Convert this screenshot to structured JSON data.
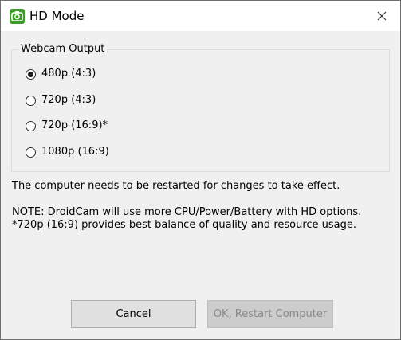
{
  "window": {
    "title": "HD Mode",
    "app_icon": "droidcam-camera-icon",
    "close_icon": "close-icon"
  },
  "group": {
    "legend": "Webcam Output",
    "options": [
      {
        "label": "480p (4:3)",
        "selected": true
      },
      {
        "label": "720p (4:3)",
        "selected": false
      },
      {
        "label": "720p (16:9)*",
        "selected": false
      },
      {
        "label": "1080p (16:9)",
        "selected": false
      }
    ]
  },
  "messages": {
    "restart_notice": "The computer needs to be restarted for changes to take effect.",
    "note_line1": "NOTE: DroidCam will use more CPU/Power/Battery with HD options.",
    "note_line2": "*720p (16:9) provides best balance of quality and resource usage."
  },
  "buttons": {
    "cancel_label": "Cancel",
    "ok_label": "OK, Restart Computer",
    "ok_enabled": false
  },
  "colors": {
    "icon_green": "#3f9b2c",
    "dialog_background": "#f0f0f0",
    "disabled_text": "#8a8a8a"
  }
}
